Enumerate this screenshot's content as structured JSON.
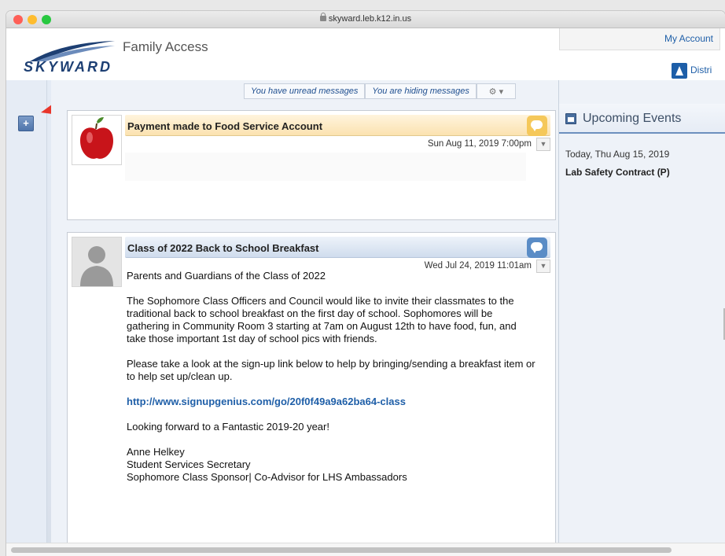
{
  "browser": {
    "url": "skyward.leb.k12.in.us"
  },
  "header": {
    "logo_text": "SKYWARD",
    "app_title": "Family Access",
    "my_account": "My Account",
    "district_label": "Distri"
  },
  "toolbar": {
    "unread": "You have unread messages",
    "hiding": "You are hiding messages",
    "gear": "⚙ ▾"
  },
  "sidebar": {
    "add_button": "+"
  },
  "messages": [
    {
      "title": "Payment made to Food Service Account",
      "date": "Sun Aug 11, 2019 7:00pm"
    },
    {
      "title": "Class of 2022 Back to School Breakfast",
      "date": "Wed Jul 24, 2019 11:01am",
      "greeting": "Parents and Guardians of the Class of 2022",
      "para1": "The Sophomore Class Officers and Council would like to invite their classmates to the traditional back to school breakfast on the first day of school. Sophomores will be gathering in Community Room 3 starting at 7am on August 12th to have food, fun, and take those important 1st day of school pics with friends.",
      "para2": "Please take a look at the sign-up link below to help by bringing/sending a breakfast item or to help set up/clean up.",
      "link": "http://www.signupgenius.com/go/20f0f49a9a62ba64-class",
      "closing": "Looking forward to a Fantastic 2019-20 year!",
      "sig_name": "Anne Helkey",
      "sig_title": "Student Services Secretary",
      "sig_role": "Sophomore Class Sponsor| Co-Advisor for LHS Ambassadors"
    }
  ],
  "events": {
    "title": "Upcoming Events",
    "date": "Today, Thu Aug 15, 2019",
    "item": "Lab Safety Contract (P)"
  },
  "colors": {
    "accent": "#1f5fa8",
    "annotation_arrow": "#e8352a"
  }
}
